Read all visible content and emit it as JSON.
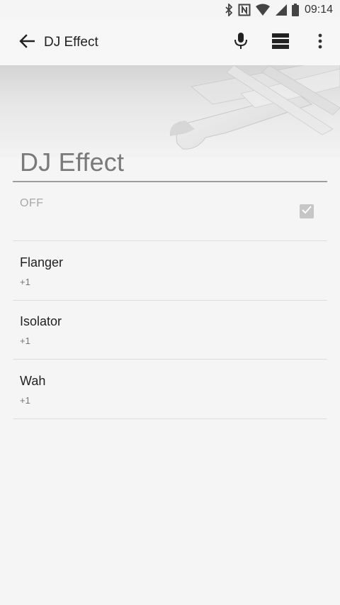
{
  "status_bar": {
    "time": "09:14",
    "icons": [
      "bluetooth-icon",
      "nfc-icon",
      "wifi-icon",
      "signal-icon",
      "battery-icon"
    ]
  },
  "app_bar": {
    "title": "DJ Effect",
    "actions": [
      "back-arrow-icon",
      "microphone-icon",
      "layout-icon",
      "more-vert-icon"
    ]
  },
  "main": {
    "heading": "DJ Effect",
    "off_setting": {
      "label": "OFF",
      "checked": true
    },
    "effects": [
      {
        "name": "Flanger",
        "value": "+1"
      },
      {
        "name": "Isolator",
        "value": "+1"
      },
      {
        "name": "Wah",
        "value": "+1"
      }
    ]
  },
  "colors": {
    "background": "#f5f5f5",
    "heading_text": "#7a7a7a",
    "divider": "#dcdcdc",
    "checkbox": "#c6c6c6"
  }
}
